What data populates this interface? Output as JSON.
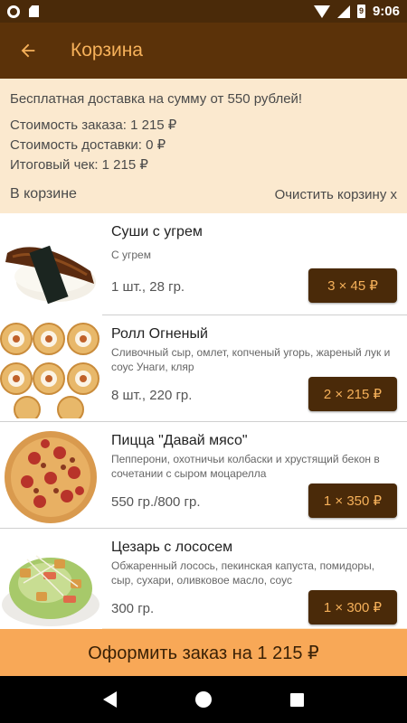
{
  "status_bar": {
    "time": "9:06",
    "battery_text": "9"
  },
  "app_bar": {
    "title": "Корзина"
  },
  "info": {
    "promo": "Бесплатная доставка на сумму от 550 рублей!",
    "order_cost": "Стоимость заказа: 1 215 ₽",
    "delivery_cost": "Стоимость доставки: 0 ₽",
    "total": "Итоговый чек: 1 215 ₽"
  },
  "cart": {
    "label": "В корзине",
    "clear_label": "Очистить корзину x"
  },
  "items": [
    {
      "name": "Суши с угрем",
      "description": "С угрем",
      "weight": "1 шт., 28 гр.",
      "qty_price": "3 × 45 ₽",
      "image": "sushi-eel"
    },
    {
      "name": "Ролл Огненый",
      "description": "Сливочный сыр, омлет, копченый угорь, жареный лук и соус Унаги, кляр",
      "weight": "8 шт., 220 гр.",
      "qty_price": "2 × 215 ₽",
      "image": "roll-fire"
    },
    {
      "name": "Пицца \"Давай мясо\"",
      "description": "Пепперони, охотничьи колбаски и хрустящий бекон в сочетании с сыром моцарелла",
      "weight": "550 гр./800 гр.",
      "qty_price": "1 × 350 ₽",
      "image": "pizza-meat"
    },
    {
      "name": "Цезарь с лососем",
      "description": "Обжаренный лосось, пекинская капуста, помидоры, сыр, сухари, оливковое масло, соус",
      "weight": "300 гр.",
      "qty_price": "1 × 300 ₽",
      "image": "caesar-salmon"
    }
  ],
  "order_button": {
    "label": "Оформить заказ на 1 215 ₽"
  },
  "colors": {
    "brand_dark": "#5b3209",
    "accent": "#f6b15a",
    "panel": "#fbe9cf",
    "order_bar": "#f8a857"
  }
}
